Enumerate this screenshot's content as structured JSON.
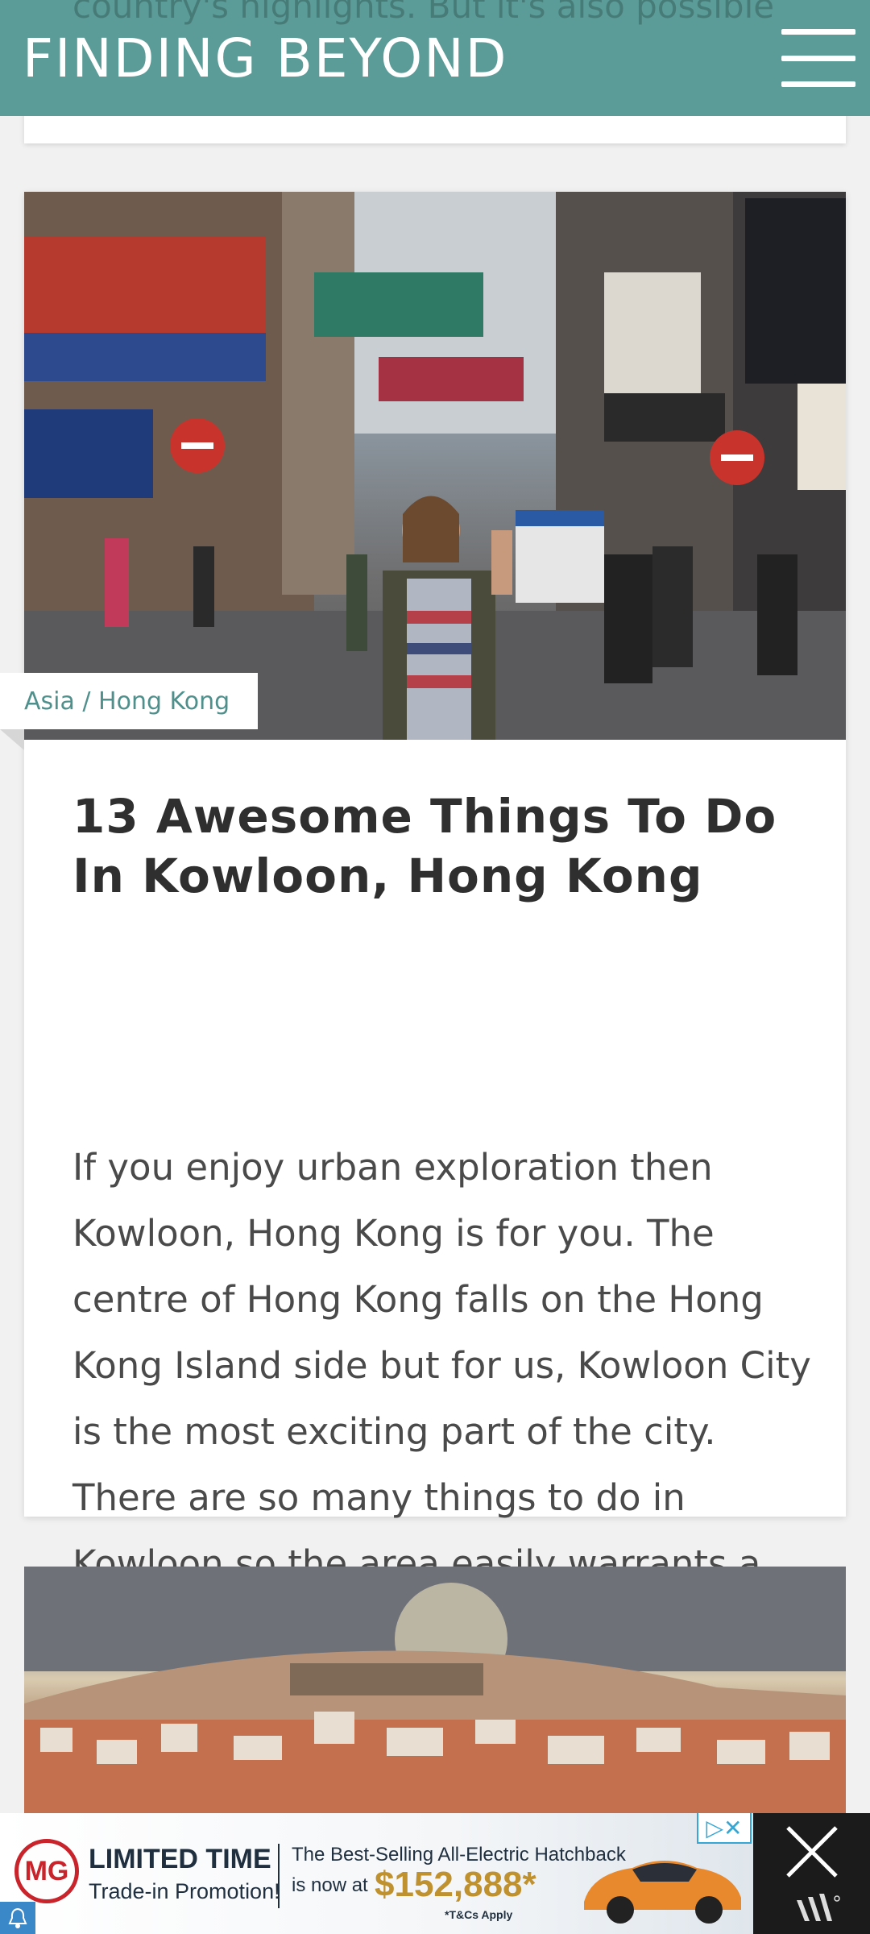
{
  "header": {
    "logo": "FINDING BEYOND",
    "behind_text": "country's highlights. But it's also possible"
  },
  "icons": {
    "menu": "hamburger-menu-icon",
    "ad_close": "close-icon",
    "ad_choices": "adchoices-icon",
    "notification": "bell-icon"
  },
  "post": {
    "category": "Asia / Hong Kong",
    "title": "13 Awesome Things To Do In Kowloon, Hong Kong",
    "excerpt": "If you enjoy urban exploration then Kowloon, Hong Kong is for you. The centre of Hong Kong falls on the Hong Kong Island side but for us, Kowloon City is the most exciting part of the city. There are so many things to do in Kowloon so the area easily warrants a couple of days or…",
    "image_alt": "Woman waving on busy Kowloon street with neon signs"
  },
  "next_post": {
    "image_alt": "Hillside city with castle at sunset"
  },
  "ad": {
    "logo_text": "MG",
    "headline": "LIMITED TIME",
    "subheadline": "Trade-in Promotion!",
    "line1": "The Best-Selling All-Electric Hatchback",
    "line2": "is now at",
    "price": "$152,888*",
    "terms": "*T&Cs Apply",
    "choices_label": "▷✕"
  },
  "colors": {
    "header_bg": "#5b9c98",
    "accent_text": "#4f8f8c",
    "ad_logo_red": "#c9232b",
    "ad_price": "#c0922f"
  }
}
